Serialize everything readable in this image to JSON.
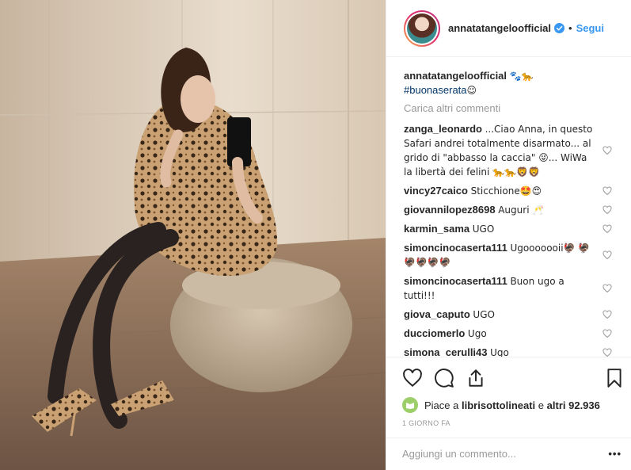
{
  "post": {
    "username": "annatatangeloofficial",
    "follow_label": "Segui",
    "separator": "•"
  },
  "caption": {
    "username": "annatatangeloofficial",
    "emoji": "🐾🐆",
    "hashtag": "#buonaserata",
    "hashtag_emoji": "😉"
  },
  "load_more": "Carica altri commenti",
  "comments": [
    {
      "user": "zanga_leonardo",
      "text": "...Ciao Anna, in questo Safari andrei totalmente disarmato... al grido di \"abbasso la caccia\" 😜... WiWa la libertà dei felini 🐆🐆🦁🦁"
    },
    {
      "user": "vincy27caico",
      "text": "Sticchione🤩😍"
    },
    {
      "user": "giovannilopez8698",
      "text": "Auguri 🥂"
    },
    {
      "user": "karmin_sama",
      "text": "UGO"
    },
    {
      "user": "simoncinocaserta111",
      "text": "Ugooooooii🦃 🦃🦃🦃🦃🦃"
    },
    {
      "user": "simoncinocaserta111",
      "text": "Buon ugo a tutti!!!"
    },
    {
      "user": "giova_caputo",
      "text": "UGO"
    },
    {
      "user": "ducciomerlo",
      "text": "Ugo"
    },
    {
      "user": "simona_cerulli43",
      "text": "Ugo"
    }
  ],
  "likes": {
    "prefix": "Piace a",
    "user": "librisottolineati",
    "mid": "e",
    "others": "altri 92.936"
  },
  "time_ago": "1 GIORNO FA",
  "add_comment_placeholder": "Aggiungi un commento...",
  "more_dots": "•••",
  "colors": {
    "accent": "#3897f0",
    "text": "#262626",
    "muted": "#999999",
    "border": "#efefef"
  }
}
